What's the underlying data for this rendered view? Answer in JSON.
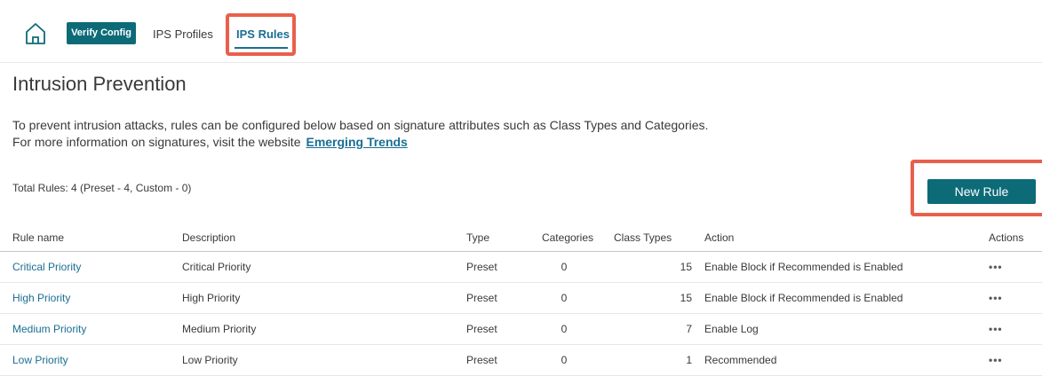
{
  "nav": {
    "home_icon": "home-icon",
    "verify_label": "Verify Config",
    "tabs": [
      {
        "label": "IPS Profiles"
      },
      {
        "label": "IPS Rules"
      }
    ]
  },
  "page": {
    "title": "Intrusion Prevention",
    "intro_line1": "To prevent intrusion attacks, rules can be configured below based on signature attributes such as Class Types and Categories.",
    "intro_line2": "For more information on signatures, visit the website",
    "intro_link": "Emerging Trends",
    "total": "Total Rules: 4 (Preset - 4, Custom - 0)",
    "new_rule_label": "New Rule"
  },
  "table": {
    "headers": {
      "name": "Rule name",
      "description": "Description",
      "type": "Type",
      "categories": "Categories",
      "class_types": "Class Types",
      "action": "Action",
      "actions": "Actions"
    },
    "rows": [
      {
        "name": "Critical Priority",
        "description": "Critical Priority",
        "type": "Preset",
        "categories": "0",
        "class_types": "15",
        "action": "Enable Block if Recommended is Enabled",
        "more": "•••"
      },
      {
        "name": "High Priority",
        "description": "High Priority",
        "type": "Preset",
        "categories": "0",
        "class_types": "15",
        "action": "Enable Block if Recommended is Enabled",
        "more": "•••"
      },
      {
        "name": "Medium Priority",
        "description": "Medium Priority",
        "type": "Preset",
        "categories": "0",
        "class_types": "7",
        "action": "Enable Log",
        "more": "•••"
      },
      {
        "name": "Low Priority",
        "description": "Low Priority",
        "type": "Preset",
        "categories": "0",
        "class_types": "1",
        "action": "Recommended",
        "more": "•••"
      }
    ]
  },
  "colors": {
    "accent": "#0d6b78",
    "link": "#1a6e93",
    "highlight": "#e8604c"
  }
}
